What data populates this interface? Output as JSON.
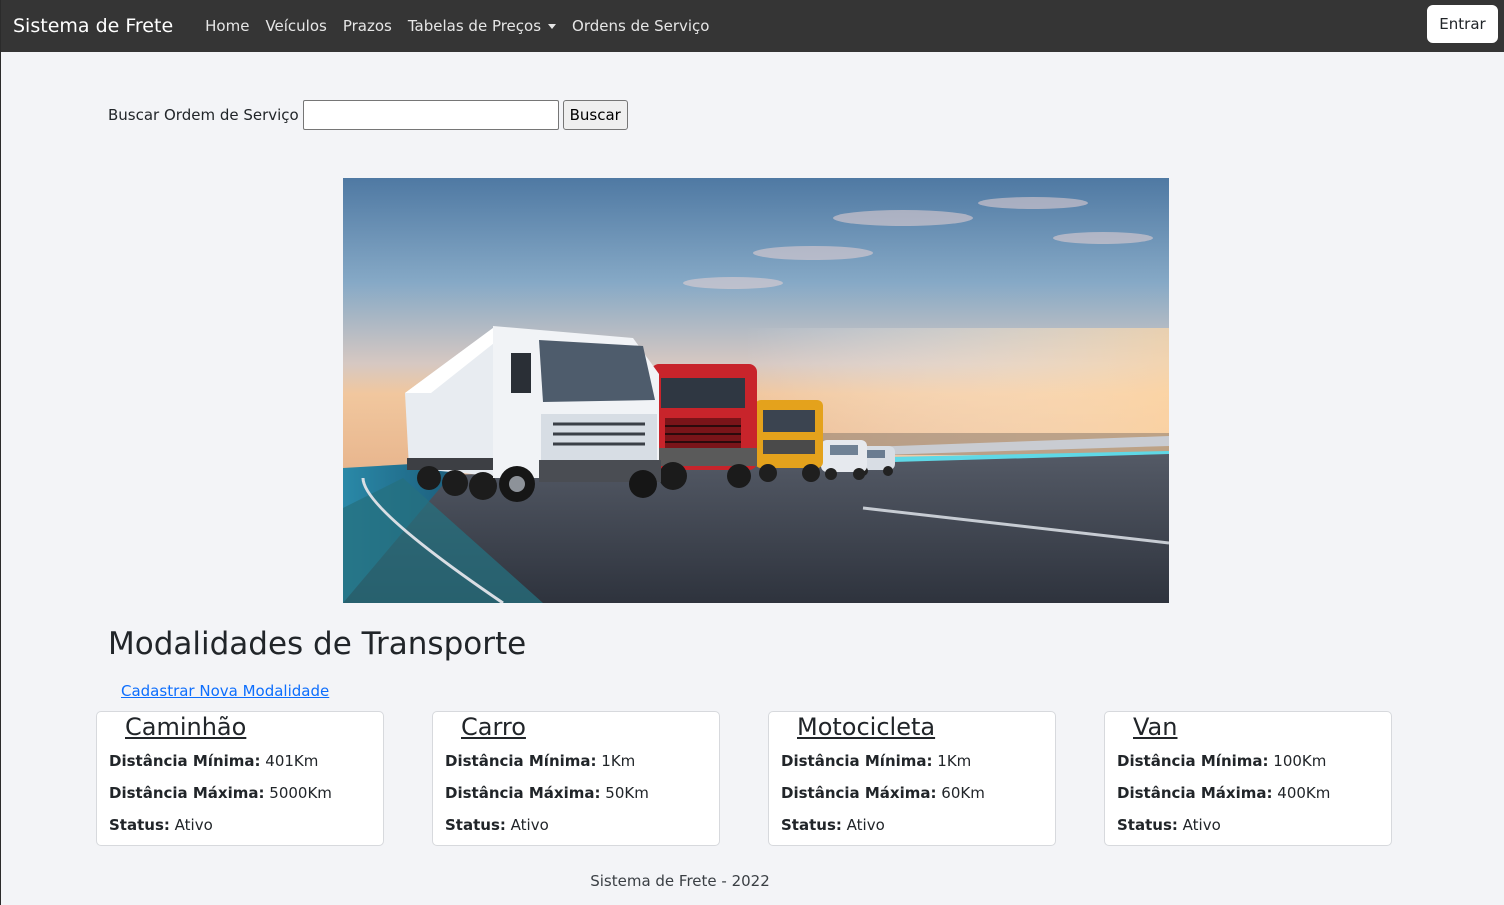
{
  "navbar": {
    "brand": "Sistema de Frete",
    "links": [
      {
        "label": "Home"
      },
      {
        "label": "Veículos"
      },
      {
        "label": "Prazos"
      },
      {
        "label": "Tabelas de Preços",
        "dropdown": true
      },
      {
        "label": "Ordens de Serviço"
      }
    ],
    "login_label": "Entrar"
  },
  "search": {
    "label": "Buscar Ordem de Serviço",
    "value": "",
    "button_label": "Buscar"
  },
  "hero": {
    "icon": "trucks-on-highway-photo"
  },
  "modalities": {
    "title": "Modalidades de Transporte",
    "new_link": "Cadastrar Nova Modalidade",
    "min_label": "Distância Mínima:",
    "max_label": "Distância Máxima:",
    "status_label": "Status:",
    "items": [
      {
        "name": "Caminhão",
        "min": "401Km",
        "max": "5000Km",
        "status": "Ativo"
      },
      {
        "name": "Carro",
        "min": "1Km",
        "max": "50Km",
        "status": "Ativo"
      },
      {
        "name": "Motocicleta",
        "min": "1Km",
        "max": "60Km",
        "status": "Ativo"
      },
      {
        "name": "Van",
        "min": "100Km",
        "max": "400Km",
        "status": "Ativo"
      }
    ]
  },
  "footer": {
    "text": "Sistema de Frete - 2022"
  },
  "colors": {
    "navbar_bg": "#353535",
    "page_bg": "#f3f4f7",
    "link": "#0d6efd"
  }
}
